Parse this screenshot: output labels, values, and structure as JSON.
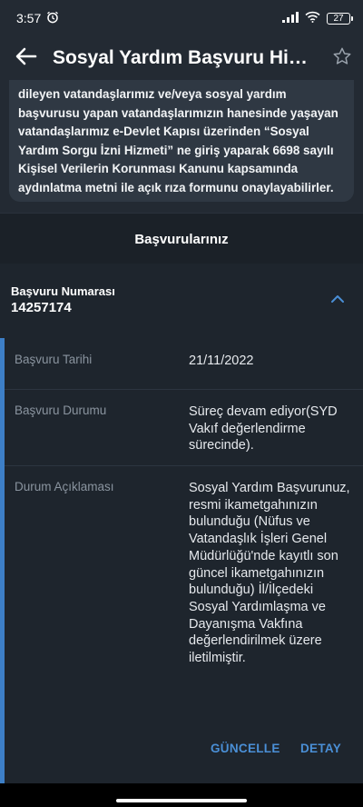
{
  "status_bar": {
    "time": "3:57",
    "battery": "27",
    "icons": [
      "alarm-icon",
      "signal-icon",
      "wifi-icon",
      "battery-icon"
    ]
  },
  "app_bar": {
    "title": "Sosyal Yardım Başvuru Hizmeti",
    "back_icon": "arrow-left-icon",
    "favorite_icon": "star-outline-icon"
  },
  "info": {
    "lines": [
      "dileyen vatandaşlarımız ve/veya sosyal yardım",
      "başvurusu yapan vatandaşlarımızın hanesinde yaşayan",
      "vatandaşlarımız e-Devlet Kapısı üzerinden “Sosyal",
      "Yardım Sorgu İzni Hizmeti” ne giriş yaparak 6698 sayılı",
      "Kişisel Verilerin Korunması Kanunu kapsamında",
      "aydınlatma metni ile açık rıza formunu onaylayabilirler."
    ]
  },
  "section": {
    "title": "Başvurularınız"
  },
  "application": {
    "number_label": "Başvuru Numarası",
    "number": "14257174",
    "details": [
      {
        "label": "Başvuru Tarihi",
        "value": "21/11/2022"
      },
      {
        "label": "Başvuru Durumu",
        "value": "Süreç devam ediyor(SYD Vakıf değerlendirme sürecinde)."
      },
      {
        "label": "Durum Açıklaması",
        "value": "Sosyal Yardım Başvurunuz, resmi ikametgahınızın bulunduğu (Nüfus ve Vatandaşlık İşleri Genel Müdürlüğü'nde kayıtlı son güncel ikametgahınızın bulunduğu) İl/İlçedeki Sosyal Yardımlaşma ve Dayanışma Vakfına değerlendirilmek üzere iletilmiştir."
      }
    ],
    "actions": {
      "update": "GÜNCELLE",
      "detail": "DETAY"
    }
  },
  "colors": {
    "accent": "#3d7fc7",
    "action": "#4a8fd6",
    "background": "#1e252d"
  }
}
